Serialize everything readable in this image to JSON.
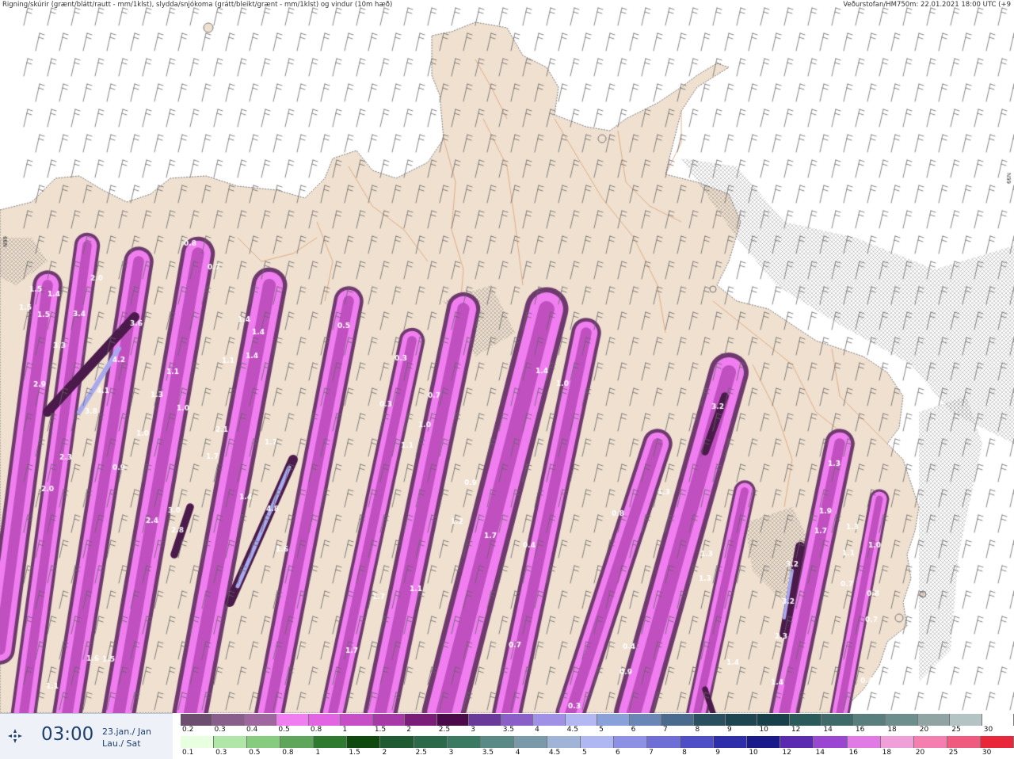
{
  "header": {
    "left": "Rigning/skúrir (grænt/blátt/rautt - mm/1klst), slydda/snjókoma (grátt/bleikt/grænt - mm/1klst) og vindur (10m hæð)",
    "right": "Veðurstofan/HM750m: 22.01.2021 18:00 UTC (+9"
  },
  "time": {
    "icon": "arrows-expand-icon",
    "main": "03:00",
    "date_line1": "23.jan./ Jan",
    "date_line2": "Lau./ Sat"
  },
  "map": {
    "graticule_labels": [
      "N99",
      "N99"
    ],
    "colors": {
      "land": "#efe0d0",
      "sea": "#ffffff",
      "border": "#e0a070",
      "coast": "#777777",
      "precip_light": "#f07ef0",
      "precip_mid": "#c050c0",
      "precip_dark": "#6e3a6e",
      "precip_core": "#4a1a4a",
      "precip_peak": "#a8a8ee",
      "wind_barb": "#666666"
    },
    "labels": [
      "1.5",
      "1.4",
      "2.0",
      "1.5",
      "3.4",
      "1.5",
      "3.3",
      "3.6",
      "4.2",
      "2.9",
      "4.1",
      "3.8",
      "2.3",
      "2.0",
      "1.1",
      "1.3",
      "1.0",
      "1.0",
      "0.9",
      "0.8",
      "0.7",
      "1.4",
      "1.4",
      "1.1",
      "1.4",
      "2.1",
      "1.7",
      "1.7",
      "1.4",
      "4.8",
      "1.6",
      "3.0",
      "2.4",
      "2.8",
      "0.5",
      "0.3",
      "0.3",
      "0.7",
      "1.0",
      "1.1",
      "0.9",
      "1.2",
      "1.7",
      "0.4",
      "1.1",
      "1.7",
      "1.7",
      "1.4",
      "1.0",
      "0.8",
      "1.3",
      "3.2",
      "1.3",
      "1.3",
      "1.3",
      "1.9",
      "1.7",
      "1.3",
      "3.2",
      "3.2",
      "1.1",
      "1.0",
      "0.7",
      "0.8",
      "0.7",
      "2.3",
      "1.4",
      "0.4",
      "1.4",
      "0.7",
      "0.4",
      "0.9",
      "0.3",
      "1.6",
      "1.5",
      "1.1"
    ]
  },
  "legend": {
    "row1": {
      "labels": [
        "0.2",
        "0.3",
        "0.4",
        "0.5",
        "0.8",
        "1",
        "1.5",
        "2",
        "2.5",
        "3",
        "3.5",
        "4",
        "4.5",
        "5",
        "6",
        "7",
        "8",
        "9",
        "10",
        "12",
        "14",
        "16",
        "18",
        "20",
        "25",
        "30"
      ],
      "colors": [
        "#6e4e6e",
        "#8a5e8a",
        "#a066a0",
        "#f07ef0",
        "#e264e2",
        "#c84ec8",
        "#a83aa8",
        "#7a1e7a",
        "#4a0a4a",
        "#6a3a9a",
        "#8a60c8",
        "#a090e6",
        "#b4b8f2",
        "#8aa0d8",
        "#6a86b6",
        "#4a6a8e",
        "#2a5060",
        "#1e4650",
        "#184048",
        "#2a5a5a",
        "#3e6a6a",
        "#587e7e",
        "#6e8e8e",
        "#90a4a4",
        "#b4c4c4",
        "#ffffff"
      ]
    },
    "row2": {
      "labels": [
        "0.1",
        "0.3",
        "0.5",
        "0.8",
        "1",
        "1.5",
        "2",
        "2.5",
        "3",
        "3.5",
        "4",
        "4.5",
        "5",
        "6",
        "7",
        "8",
        "9",
        "10",
        "12",
        "14",
        "16",
        "18",
        "20",
        "25",
        "30"
      ],
      "colors": [
        "#e8ffe0",
        "#b0e6a8",
        "#86cc7e",
        "#5ea65a",
        "#2e7a2e",
        "#0e4a0e",
        "#1e5a32",
        "#2a6a4a",
        "#3a7a62",
        "#5a8a86",
        "#7a9aaa",
        "#a0b4d8",
        "#b0b8f4",
        "#8e90e6",
        "#6e6ed6",
        "#4e4ec6",
        "#2e2eaa",
        "#1a1a8a",
        "#5a2ab0",
        "#9a46d2",
        "#e27ae6",
        "#f0a0d8",
        "#f47eb0",
        "#f05a7e",
        "#e8283a"
      ]
    }
  }
}
